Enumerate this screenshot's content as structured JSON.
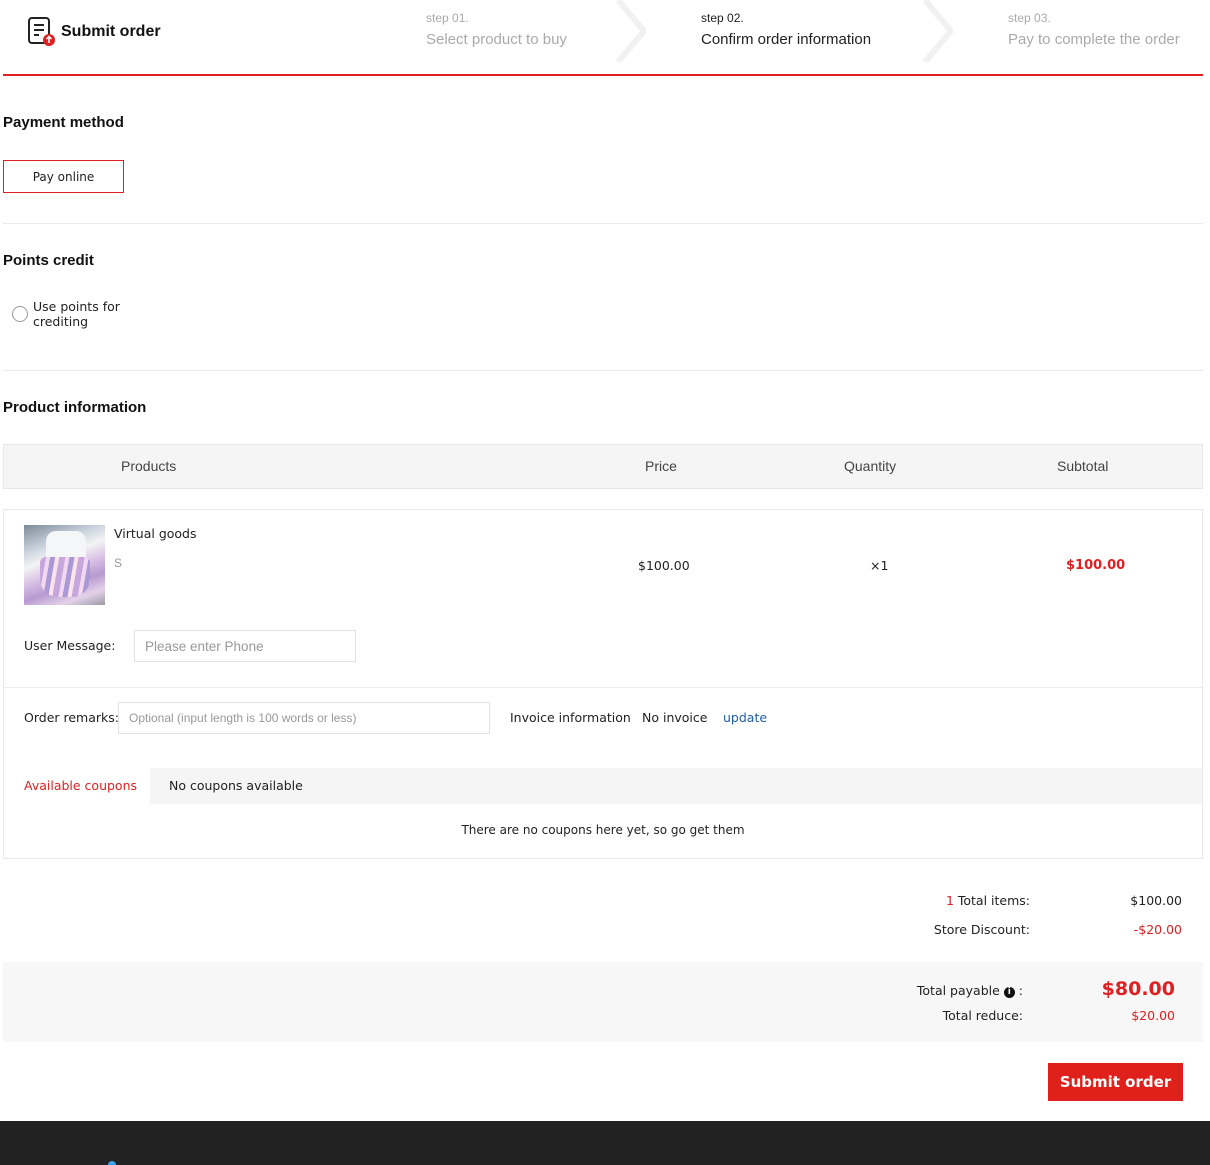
{
  "header": {
    "title": "Submit order",
    "steps": [
      {
        "num": "step 01.",
        "label": "Select product to buy"
      },
      {
        "num": "step 02.",
        "label": "Confirm order information"
      },
      {
        "num": "step 03.",
        "label": "Pay to complete the order"
      }
    ],
    "active_step": 2,
    "accent_color": "#e02020"
  },
  "payment": {
    "title": "Payment method",
    "option": "Pay online"
  },
  "points": {
    "title": "Points credit",
    "option": "Use points for crediting"
  },
  "products": {
    "title": "Product information",
    "columns": [
      "Products",
      "Price",
      "Quantity",
      "Subtotal"
    ],
    "items": [
      {
        "name": "Virtual goods",
        "spec": "S",
        "price": "$100.00",
        "quantity": "×1",
        "subtotal": "$100.00"
      }
    ],
    "user_message_label": "User Message:",
    "user_message_placeholder": "Please enter Phone",
    "remarks_label": "Order remarks:",
    "remarks_placeholder": "Optional (input length is 100 words or less)",
    "invoice_label": "Invoice information",
    "invoice_value": "No invoice",
    "invoice_update": "update"
  },
  "coupons": {
    "tab_active": "Available coupons",
    "tab_other": "No coupons available",
    "empty_text": "There are no coupons here yet, so go get them"
  },
  "summary": {
    "items_count": "1",
    "items_label": " Total items:",
    "items_value": "$100.00",
    "discount_label": "Store Discount:",
    "discount_value": "-$20.00",
    "payable_label": "Total payable",
    "payable_value": "$80.00",
    "reduce_label": "Total reduce:",
    "reduce_value": "$20.00"
  },
  "submit_label": "Submit order"
}
